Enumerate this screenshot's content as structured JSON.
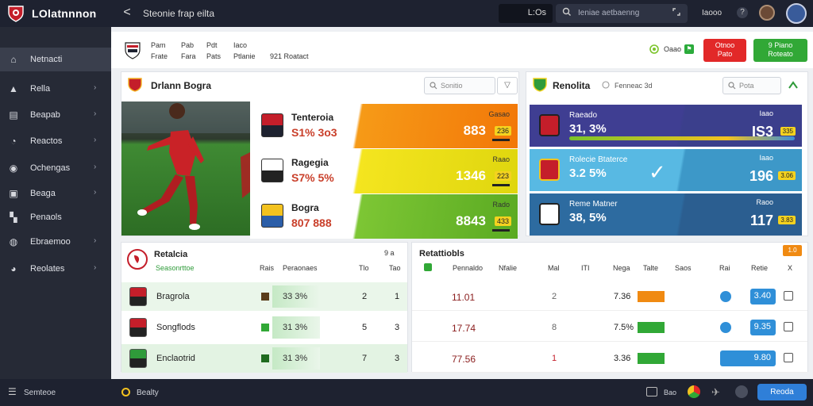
{
  "topbar": {
    "app_title": "LOlatnnnon",
    "back_label": "<",
    "page_heading": "Steonie frap eilta",
    "score_box": "L:Os",
    "search_placeholder": "Ieniae aetbaenng",
    "user_label": "Iaooo",
    "help_icon_char": "?"
  },
  "sidebar": {
    "items": [
      {
        "label": "Netnacti",
        "icon": "home-icon",
        "glyph": "⌂",
        "chevron": false,
        "active": true
      },
      {
        "label": "Rella",
        "icon": "chart-icon",
        "glyph": "▲",
        "chevron": true,
        "active": false
      },
      {
        "label": "Beapab",
        "icon": "document-icon",
        "glyph": "▤",
        "chevron": true,
        "active": false
      },
      {
        "label": "Reactos",
        "icon": "whistle-icon",
        "glyph": "◔",
        "chevron": true,
        "active": false
      },
      {
        "label": "Ochengas",
        "icon": "ball-icon",
        "glyph": "◉",
        "chevron": true,
        "active": false
      },
      {
        "label": "Beaga",
        "icon": "calendar-icon",
        "glyph": "▣",
        "chevron": true,
        "active": false
      },
      {
        "label": "Penaols",
        "icon": "flag-icon",
        "glyph": "▚",
        "chevron": false,
        "active": false
      },
      {
        "label": "Ebraemoo",
        "icon": "trophy-icon",
        "glyph": "◍",
        "chevron": true,
        "active": false
      },
      {
        "label": "Reolates",
        "icon": "settings-icon",
        "glyph": "◕",
        "chevron": true,
        "active": false
      }
    ]
  },
  "header": {
    "cols": [
      {
        "top": "Pam",
        "bottom": "Frate"
      },
      {
        "top": "Pab",
        "bottom": "Fara"
      },
      {
        "top": "Pdt",
        "bottom": "Pats"
      },
      {
        "top": "Iaco",
        "bottom": "Ptlanie"
      }
    ],
    "date": "921 Roatact",
    "status_code": "Oaao",
    "btn_red": {
      "line1": "Otnoo",
      "line2": "Pato"
    },
    "btn_green": {
      "line1": "9 Piano",
      "line2": "Roteato"
    }
  },
  "matches_panel": {
    "title": "Drlann Bogra",
    "filter_placeholder": "Sonitio",
    "rows": [
      {
        "team": "Tenteroia",
        "score": "S1% 3o3",
        "label": "Gasao",
        "value": "883",
        "chip": "236",
        "color1": "#f69a17",
        "color2": "#f27708"
      },
      {
        "team": "Ragegia",
        "score": "S7% 5%",
        "label": "Raao",
        "value": "1346",
        "chip": "223",
        "color1": "#f4e51f",
        "color2": "#dfd60e"
      },
      {
        "team": "Bogra",
        "score": "807 888",
        "label": "Rado",
        "value": "8843",
        "chip": "433",
        "color1": "#7dc634",
        "color2": "#5aaa22"
      }
    ]
  },
  "odds_panel": {
    "title": "Renolita",
    "subtitle": "Fenneac 3d",
    "filter_placeholder": "Pota",
    "rows": [
      {
        "name": "Raeado",
        "score": "31, 3%",
        "label": "Iaao",
        "value": "IS3",
        "chip": "335",
        "color1": "#3f3e92",
        "color2": "#3b3f8c"
      },
      {
        "name": "Rolecie Btaterce",
        "score": "3.2 5%",
        "label": "Iaao",
        "value": "196",
        "chip": "3.06",
        "color1": "#58b9e3",
        "color2": "#3d98c8"
      },
      {
        "name": "Reme Matner",
        "score": "38, 5%",
        "label": "Raoo",
        "value": "117",
        "chip": "3.83",
        "color1": "#2d6ba0",
        "color2": "#2b5e90"
      }
    ]
  },
  "table": {
    "title": "Retalcia",
    "subtitle": "Seasonrttoe",
    "headers": [
      "Rais",
      "Peraonaes",
      "Tlo",
      "Tao"
    ],
    "right_title": "Retattiobls",
    "right_headers": [
      "Pennaldo",
      "Nfalie",
      "Mal",
      "ITI",
      "Nega",
      "Talte",
      "Saos",
      "Rai",
      "Retie",
      "X"
    ],
    "badge": "1.0",
    "page_info": "9 a",
    "rows": [
      {
        "team": "Bragrola",
        "stat": "33 3%",
        "a": "2",
        "b": "1",
        "time": "11.01",
        "n": "2",
        "pct": "7.36",
        "odd": "3.40"
      },
      {
        "team": "Songflods",
        "stat": "31 3%",
        "a": "5",
        "b": "3",
        "time": "17.74",
        "n": "8",
        "pct": "7.5%",
        "odd": "9.35"
      },
      {
        "team": "Enclaotrid",
        "stat": "31 3%",
        "a": "7",
        "b": "3",
        "time": "77.56",
        "n": "1",
        "pct": "3.36",
        "odd": "9.80"
      }
    ]
  },
  "bottombar": {
    "left_label": "Semteoe",
    "status_label": "Bealty",
    "right_label": "Reoda",
    "chat_label": "Bao"
  }
}
